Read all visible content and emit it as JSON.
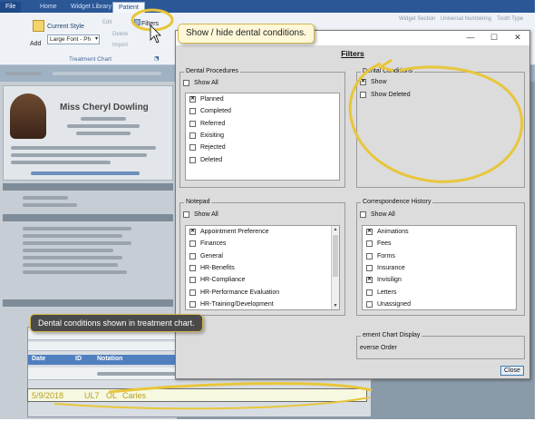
{
  "ribbon": {
    "tabs": [
      "File",
      "Home",
      "Widget Library",
      "Patient"
    ],
    "active_tab": "Patient",
    "current_style_label": "Current Style",
    "add_label": "Add",
    "font_select_value": "Large Font - Ph",
    "filters_label": "Filters",
    "edit_label": "Edit",
    "delete_label": "Delete",
    "import_label": "Import",
    "group_label": "Treatment Chart",
    "right_items": [
      "Widget Section",
      "Universal Numbering",
      "Tooth Type"
    ]
  },
  "callouts": {
    "top": "Show / hide dental conditions.",
    "bottom": "Dental conditions shown in treatment chart."
  },
  "dialog": {
    "heading": "Filters",
    "dental_procedures": {
      "label": "Dental Procedures",
      "show_all": "Show All",
      "items": [
        {
          "label": "Planned",
          "checked": true
        },
        {
          "label": "Completed",
          "checked": false
        },
        {
          "label": "Referred",
          "checked": false
        },
        {
          "label": "Exisiting",
          "checked": false
        },
        {
          "label": "Rejected",
          "checked": false
        },
        {
          "label": "Deleted",
          "checked": false
        }
      ]
    },
    "dental_conditions": {
      "label": "Dental Conditions",
      "items": [
        {
          "label": "Show",
          "checked": true
        },
        {
          "label": "Show Deleted",
          "checked": false
        }
      ]
    },
    "notepad": {
      "label": "Notepad",
      "show_all": "Show All",
      "items": [
        {
          "label": "Appointment Preference",
          "checked": true
        },
        {
          "label": "Finances",
          "checked": false
        },
        {
          "label": "General",
          "checked": false
        },
        {
          "label": "HR-Benefits",
          "checked": false
        },
        {
          "label": "HR-Compliance",
          "checked": false
        },
        {
          "label": "HR-Performance Evaluation",
          "checked": false
        },
        {
          "label": "HR-Training/Development",
          "checked": false
        }
      ]
    },
    "correspondence_history": {
      "label": "Correspondence History",
      "show_all": "Show All",
      "items": [
        {
          "label": "Animations",
          "checked": true
        },
        {
          "label": "Fees",
          "checked": false
        },
        {
          "label": "Forms",
          "checked": false
        },
        {
          "label": "Insurance",
          "checked": false
        },
        {
          "label": "Invisilign",
          "checked": true
        },
        {
          "label": "Letters",
          "checked": false
        },
        {
          "label": "Unassigned",
          "checked": false
        }
      ]
    },
    "treatment_display": {
      "label": "ement Chart Display",
      "option": "everse Order"
    },
    "close_label": "Close"
  },
  "background": {
    "patient_name": "Miss Cheryl Dowling",
    "chart_columns": [
      "Date",
      "ID",
      "Notation"
    ],
    "highlight_row": {
      "date": "5/9/2018",
      "tooth": "UL7",
      "surface": "OL",
      "condition": "Caries"
    }
  },
  "colors": {
    "callout_bg": "#fff8d8",
    "callout_border": "#d8b84a",
    "dialog_bg": "#dcdcdc",
    "ribbon_blue": "#2b5797",
    "highlight_text": "#b8a020"
  }
}
